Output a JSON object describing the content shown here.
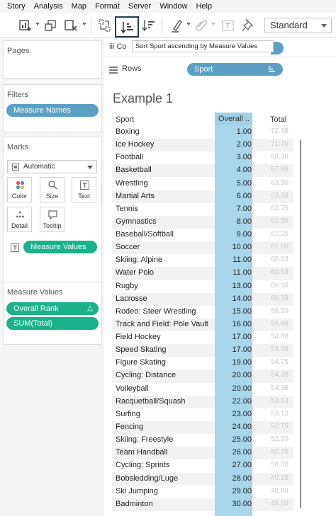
{
  "menu": [
    "Story",
    "Analysis",
    "Map",
    "Format",
    "Server",
    "Window",
    "Help"
  ],
  "toolbar": {
    "icons": [
      "add-chart-icon",
      "duplicate-icon",
      "clear-icon",
      "swap-icon",
      "sort-ascending-icon",
      "sort-descending-icon",
      "highlight-icon",
      "pin-icon"
    ],
    "fit_select": "Standard"
  },
  "tooltip": "Sort Sport ascending by Measure Values",
  "panels": {
    "pages_title": "Pages",
    "filters_title": "Filters",
    "filters_pill": "Measure Names",
    "marks_title": "Marks",
    "marks_type": "Automatic",
    "mark_buttons": [
      "Color",
      "Size",
      "Text",
      "Detail",
      "Tooltip"
    ],
    "marks_pill": "Measure Values",
    "mv_title": "Measure Values",
    "mv_pills": [
      "Overall Rank",
      "SUM(Total)"
    ]
  },
  "shelves": {
    "columns_label": "iii Co",
    "rows_label": "Rows",
    "rows_pill": "Sport"
  },
  "sheet": {
    "title": "Example 1",
    "col_sport": "Sport",
    "col_overall": "Overall ..",
    "col_total": "Total",
    "rows": [
      {
        "sport": "Boxing",
        "rank": "1.00",
        "total": "72.38"
      },
      {
        "sport": "Ice Hockey",
        "rank": "2.00",
        "total": "71.75"
      },
      {
        "sport": "Football",
        "rank": "3.00",
        "total": "68.38"
      },
      {
        "sport": "Basketball",
        "rank": "4.00",
        "total": "67.88"
      },
      {
        "sport": "Wrestling",
        "rank": "5.00",
        "total": "63.50"
      },
      {
        "sport": "Martial Arts",
        "rank": "6.00",
        "total": "63.38"
      },
      {
        "sport": "Tennis",
        "rank": "7.00",
        "total": "62.75"
      },
      {
        "sport": "Gymnastics",
        "rank": "8.00",
        "total": "62.50"
      },
      {
        "sport": "Baseball/Softball",
        "rank": "9.00",
        "total": "62.25"
      },
      {
        "sport": "Soccer",
        "rank": "10.00",
        "total": "61.50"
      },
      {
        "sport": "Skiing: Alpine",
        "rank": "11.00",
        "total": "60.63"
      },
      {
        "sport": "Water Polo",
        "rank": "11.00",
        "total": "60.63"
      },
      {
        "sport": "Rugby",
        "rank": "13.00",
        "total": "60.50"
      },
      {
        "sport": "Lacrosse",
        "rank": "14.00",
        "total": "60.38"
      },
      {
        "sport": "Rodeo: Steer Wrestling",
        "rank": "15.00",
        "total": "56.50"
      },
      {
        "sport": "Track and Field: Pole Vault",
        "rank": "16.00",
        "total": "55.88"
      },
      {
        "sport": "Field Hockey",
        "rank": "17.00",
        "total": "54.88"
      },
      {
        "sport": "Speed Skating",
        "rank": "17.00",
        "total": "54.88"
      },
      {
        "sport": "Figure Skating",
        "rank": "19.00",
        "total": "54.75"
      },
      {
        "sport": "Cycling: Distance",
        "rank": "20.00",
        "total": "54.38"
      },
      {
        "sport": "Volleyball",
        "rank": "20.00",
        "total": "54.38"
      },
      {
        "sport": "Racquetball/Squash",
        "rank": "22.00",
        "total": "53.63"
      },
      {
        "sport": "Surfing",
        "rank": "23.00",
        "total": "53.13"
      },
      {
        "sport": "Fencing",
        "rank": "24.00",
        "total": "52.75"
      },
      {
        "sport": "Skiing: Freestyle",
        "rank": "25.00",
        "total": "52.50"
      },
      {
        "sport": "Team Handball",
        "rank": "26.00",
        "total": "50.75"
      },
      {
        "sport": "Cycling: Sprints",
        "rank": "27.00",
        "total": "50.00"
      },
      {
        "sport": "Bobsledding/Luge",
        "rank": "28.00",
        "total": "49.25"
      },
      {
        "sport": "Ski Jumping",
        "rank": "29.00",
        "total": "48.88"
      },
      {
        "sport": "Badminton",
        "rank": "30.00",
        "total": "48.00"
      }
    ]
  }
}
